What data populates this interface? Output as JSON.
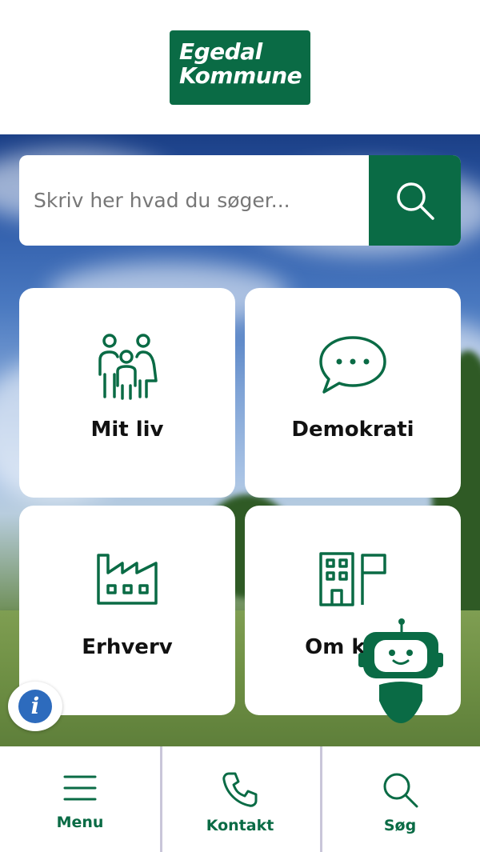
{
  "logo": {
    "line1": "Egedal",
    "line2": "Kommune"
  },
  "search": {
    "placeholder": "Skriv her hvad du søger..."
  },
  "tiles": [
    {
      "label": "Mit liv",
      "icon": "family-icon"
    },
    {
      "label": "Demokrati",
      "icon": "speech-bubble-icon"
    },
    {
      "label": "Erhverv",
      "icon": "factory-icon"
    },
    {
      "label": "Om kom",
      "icon": "building-flag-icon"
    }
  ],
  "bottom_nav": [
    {
      "label": "Menu",
      "icon": "hamburger-menu-icon"
    },
    {
      "label": "Kontakt",
      "icon": "phone-icon"
    },
    {
      "label": "Søg",
      "icon": "search-icon"
    }
  ],
  "colors": {
    "brand_green": "#0a6b45",
    "info_blue": "#2d6bbd",
    "divider": "#c9c6d9"
  }
}
